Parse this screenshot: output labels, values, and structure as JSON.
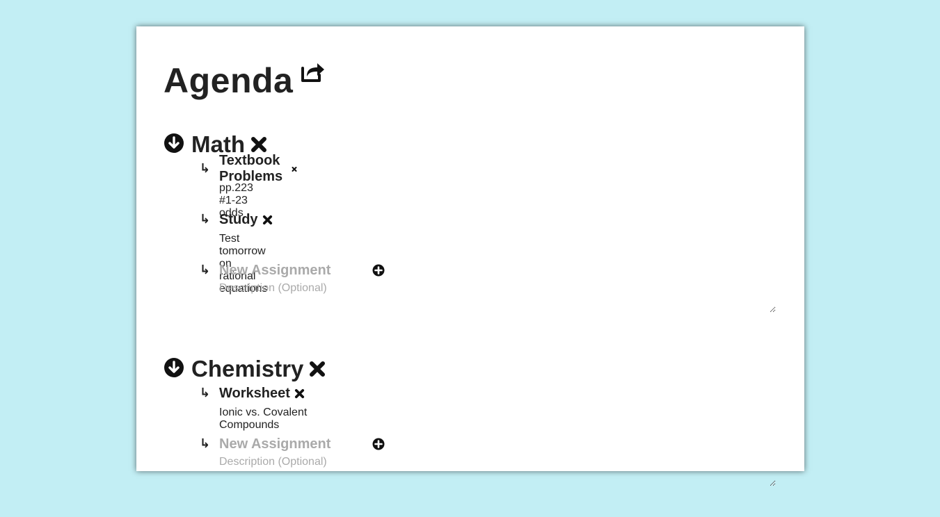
{
  "page": {
    "title": "Agenda",
    "share_icon": "share-icon"
  },
  "colors": {
    "background": "#c2eef4",
    "card": "#ffffff",
    "text": "#222222",
    "placeholder": "#aaaaaa"
  },
  "subjects": [
    {
      "name": "Math",
      "collapse_icon": "arrow-circle-down-icon",
      "delete_icon": "close-icon",
      "assignments": [
        {
          "title": "Textbook Problems",
          "description": "pp.223 #1-23 odds"
        },
        {
          "title": "Study",
          "description": "Test tomorrow on rational equations"
        }
      ],
      "new_assignment": {
        "title_placeholder": "New Assignment",
        "description_placeholder": "Description (Optional)",
        "add_icon": "plus-circle-icon"
      }
    },
    {
      "name": "Chemistry",
      "collapse_icon": "arrow-circle-down-icon",
      "delete_icon": "close-icon",
      "assignments": [
        {
          "title": "Worksheet",
          "description": "Ionic vs. Covalent Compounds"
        }
      ],
      "new_assignment": {
        "title_placeholder": "New Assignment",
        "description_placeholder": "Description (Optional)",
        "add_icon": "plus-circle-icon"
      }
    }
  ],
  "arrow_glyph": "↳"
}
